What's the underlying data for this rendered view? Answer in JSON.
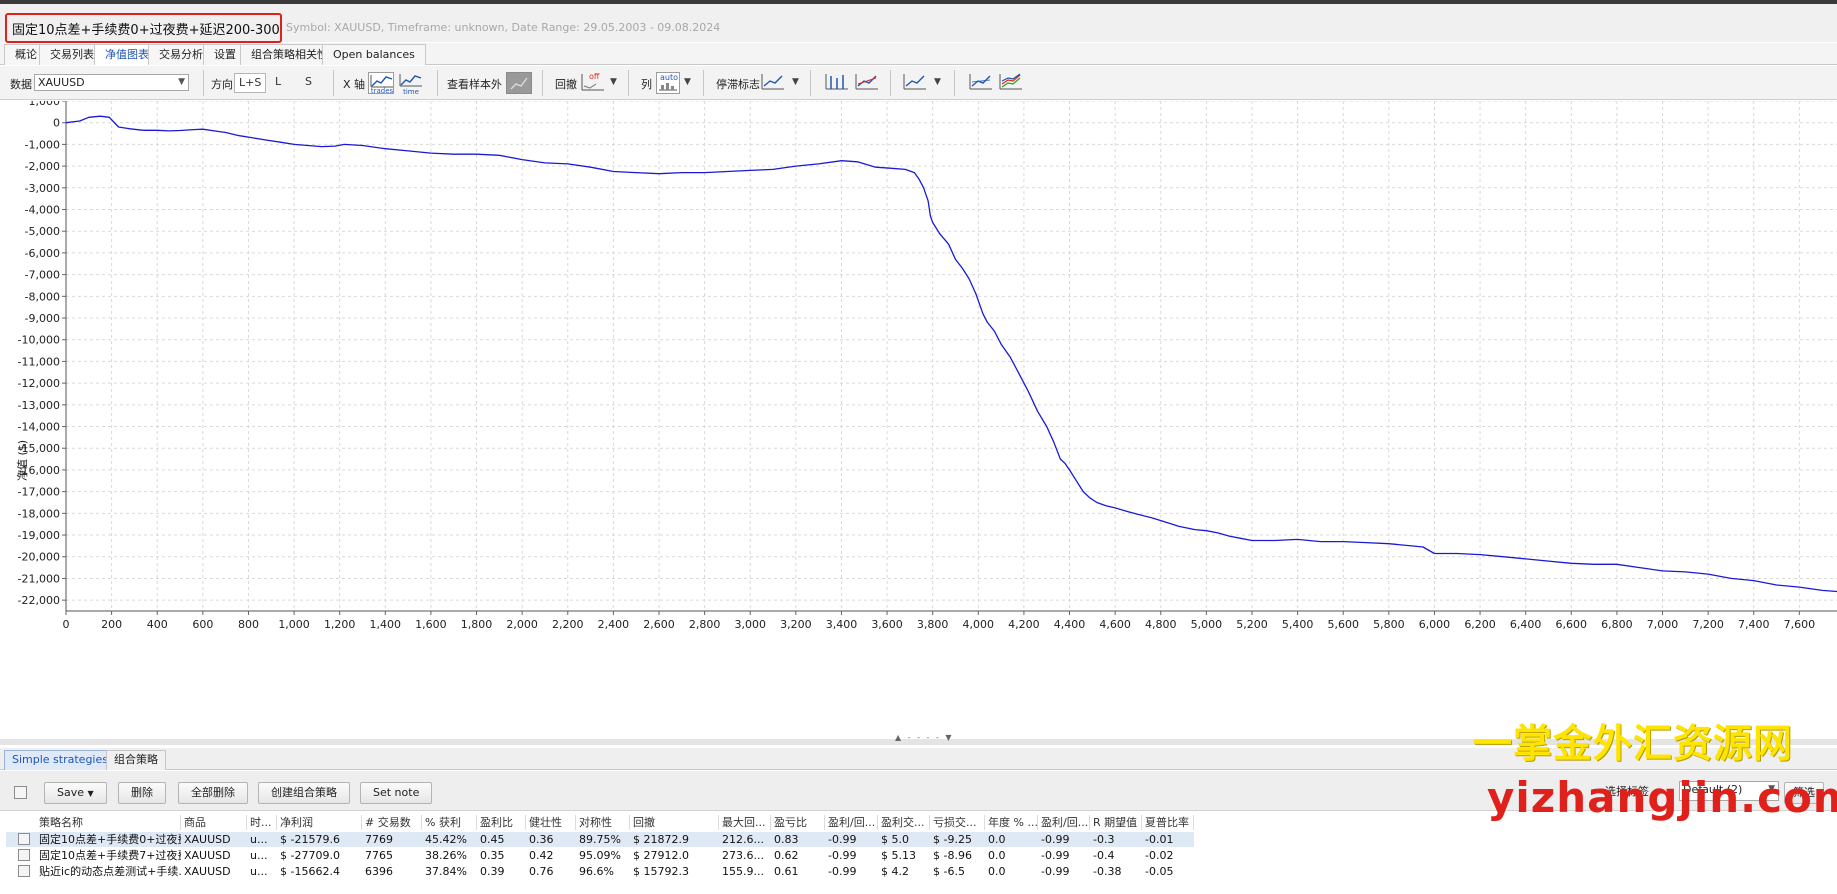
{
  "header": {
    "title": "固定10点差+手续费0+过夜费+延迟200-300",
    "subtitle": "Symbol: XAUUSD, Timeframe: unknown, Date Range: 29.05.2003 - 09.08.2024"
  },
  "tabs": [
    {
      "label": "概论",
      "active": false
    },
    {
      "label": "交易列表",
      "active": false
    },
    {
      "label": "净值图表",
      "active": true
    },
    {
      "label": "交易分析",
      "active": false
    },
    {
      "label": "设置",
      "active": false
    },
    {
      "label": "组合策略相关性",
      "active": false
    },
    {
      "label": "Open balances",
      "active": false
    }
  ],
  "toolbar": {
    "data_label": "数据",
    "symbol_value": "XAUUSD",
    "direction_label": "方向",
    "direction_options": [
      "L+S",
      "L",
      "S"
    ],
    "direction_selected": "L+S",
    "xaxis_label": "X 轴",
    "xaxis_trades": "trades",
    "xaxis_time": "time",
    "oos_label": "查看样本外",
    "drawdown_label": "回撤",
    "drawdown_state": "off",
    "columns_label": "列",
    "columns_state": "auto",
    "markers_label": "停滞标志"
  },
  "chart_data": {
    "type": "line",
    "xlabel": "",
    "ylabel": "净值 ($)",
    "xlim": [
      0,
      7765
    ],
    "ylim": [
      -22500,
      1000
    ],
    "grid": true,
    "x_ticks": [
      0,
      200,
      400,
      600,
      800,
      1000,
      1200,
      1400,
      1600,
      1800,
      2000,
      2200,
      2400,
      2600,
      2800,
      3000,
      3200,
      3400,
      3600,
      3800,
      4000,
      4200,
      4400,
      4600,
      4800,
      5000,
      5200,
      5400,
      5600,
      5800,
      6000,
      6200,
      6400,
      6600,
      6800,
      7000,
      7200,
      7400,
      7600
    ],
    "x_tick_labels": [
      "0",
      "200",
      "400",
      "600",
      "800",
      "1,000",
      "1,200",
      "1,400",
      "1,600",
      "1,800",
      "2,000",
      "2,200",
      "2,400",
      "2,600",
      "2,800",
      "3,000",
      "3,200",
      "3,400",
      "3,600",
      "3,800",
      "4,000",
      "4,200",
      "4,400",
      "4,600",
      "4,800",
      "5,000",
      "5,200",
      "5,400",
      "5,600",
      "5,800",
      "6,000",
      "6,200",
      "6,400",
      "6,600",
      "6,800",
      "7,000",
      "7,200",
      "7,400",
      "7,600"
    ],
    "y_ticks": [
      1000,
      0,
      -1000,
      -2000,
      -3000,
      -4000,
      -5000,
      -6000,
      -7000,
      -8000,
      -9000,
      -10000,
      -11000,
      -12000,
      -13000,
      -14000,
      -15000,
      -16000,
      -17000,
      -18000,
      -19000,
      -20000,
      -21000,
      -22000
    ],
    "y_tick_labels": [
      "1,000",
      "0",
      "-1,000",
      "-2,000",
      "-3,000",
      "-4,000",
      "-5,000",
      "-6,000",
      "-7,000",
      "-8,000",
      "-9,000",
      "-10,000",
      "-11,000",
      "-12,000",
      "-13,000",
      "-14,000",
      "-15,000",
      "-16,000",
      "-17,000",
      "-18,000",
      "-19,000",
      "-20,000",
      "-21,000",
      "-22,000"
    ],
    "series": [
      {
        "color": "#1a1ad6",
        "x": [
          0,
          60,
          100,
          150,
          190,
          230,
          280,
          340,
          400,
          450,
          500,
          560,
          600,
          650,
          700,
          760,
          820,
          880,
          940,
          1000,
          1060,
          1120,
          1180,
          1220,
          1300,
          1400,
          1500,
          1600,
          1700,
          1800,
          1900,
          2000,
          2100,
          2200,
          2300,
          2400,
          2500,
          2600,
          2700,
          2800,
          2900,
          3000,
          3100,
          3200,
          3300,
          3400,
          3470,
          3550,
          3620,
          3680,
          3720,
          3740,
          3760,
          3780,
          3790,
          3800,
          3830,
          3870,
          3900,
          3930,
          3960,
          3990,
          4020,
          4040,
          4070,
          4100,
          4140,
          4180,
          4220,
          4260,
          4300,
          4330,
          4360,
          4380,
          4400,
          4430,
          4460,
          4490,
          4520,
          4560,
          4600,
          4650,
          4700,
          4760,
          4820,
          4880,
          4950,
          5000,
          5050,
          5100,
          5150,
          5200,
          5300,
          5400,
          5500,
          5600,
          5700,
          5800,
          5900,
          5950,
          6000,
          6100,
          6200,
          6300,
          6400,
          6500,
          6600,
          6700,
          6800,
          6900,
          7000,
          7100,
          7200,
          7300,
          7400,
          7500,
          7600,
          7700,
          7765
        ],
        "y": [
          0,
          80,
          250,
          300,
          250,
          -200,
          -280,
          -350,
          -350,
          -380,
          -360,
          -320,
          -300,
          -380,
          -450,
          -600,
          -700,
          -800,
          -900,
          -1000,
          -1050,
          -1100,
          -1080,
          -1000,
          -1050,
          -1200,
          -1300,
          -1400,
          -1450,
          -1450,
          -1500,
          -1700,
          -1850,
          -1900,
          -2050,
          -2250,
          -2300,
          -2350,
          -2300,
          -2300,
          -2250,
          -2200,
          -2150,
          -2000,
          -1900,
          -1750,
          -1800,
          -2050,
          -2100,
          -2150,
          -2300,
          -2600,
          -3000,
          -3600,
          -4300,
          -4600,
          -5100,
          -5600,
          -6300,
          -6700,
          -7200,
          -7900,
          -8800,
          -9200,
          -9600,
          -10200,
          -10800,
          -11600,
          -12400,
          -13300,
          -14000,
          -14700,
          -15500,
          -15700,
          -16000,
          -16500,
          -17000,
          -17300,
          -17500,
          -17650,
          -17750,
          -17900,
          -18050,
          -18200,
          -18400,
          -18600,
          -18750,
          -18800,
          -18900,
          -19050,
          -19150,
          -19250,
          -19250,
          -19200,
          -19300,
          -19300,
          -19350,
          -19400,
          -19500,
          -19550,
          -19850,
          -19850,
          -19900,
          -20000,
          -20100,
          -20200,
          -20300,
          -20350,
          -20350,
          -20500,
          -20650,
          -20700,
          -20800,
          -21000,
          -21100,
          -21300,
          -21400,
          -21550,
          -21600
        ]
      }
    ]
  },
  "bottom": {
    "tabs": [
      {
        "label": "Simple strategies",
        "active": true
      },
      {
        "label": "组合策略",
        "active": false
      }
    ],
    "buttons": {
      "save": "Save",
      "delete": "删除",
      "delete_all": "全部删除",
      "create_portfolio": "创建组合策略",
      "set_note": "Set note"
    },
    "right_label": "选择标签",
    "right_select": "Default (2)",
    "right_button": "筛选",
    "columns": [
      "策略名称",
      "商品",
      "时...",
      "净利润",
      "# 交易数",
      "% 获利",
      "盈利比",
      "健壮性",
      "对称性",
      "回撤",
      "最大回...",
      "盈亏比",
      "盈利/回...",
      "盈利交...",
      "亏损交...",
      "年度 % ...",
      "盈利/回...",
      "R 期望值",
      "夏普比率"
    ],
    "rows": [
      [
        "固定10点差+手续费0+过夜费...",
        "XAUUSD",
        "u...",
        "$ -21579.6",
        "7769",
        "45.42%",
        "0.45",
        "0.36",
        "89.75%",
        "$ 21872.9",
        "212.6...",
        "0.83",
        "-0.99",
        "$ 5.0",
        "$ -9.25",
        "0.0",
        "-0.99",
        "-0.3",
        "-0.01"
      ],
      [
        "固定10点差+手续费7+过夜费...",
        "XAUUSD",
        "u...",
        "$ -27709.0",
        "7765",
        "38.26%",
        "0.35",
        "0.42",
        "95.09%",
        "$ 27912.0",
        "273.6...",
        "0.62",
        "-0.99",
        "$ 5.13",
        "$ -8.96",
        "0.0",
        "-0.99",
        "-0.4",
        "-0.02"
      ],
      [
        "贴近ic的动态点差测试+手续...",
        "XAUUSD",
        "u...",
        "$ -15662.4",
        "6396",
        "37.84%",
        "0.39",
        "0.76",
        "96.6%",
        "$ 15792.3",
        "155.9...",
        "0.61",
        "-0.99",
        "$ 4.2",
        "$ -6.5",
        "0.0",
        "-0.99",
        "-0.38",
        "-0.05"
      ]
    ]
  },
  "watermark": {
    "line1": "一掌金外汇资源网",
    "line2": "yizhangjin.com"
  }
}
